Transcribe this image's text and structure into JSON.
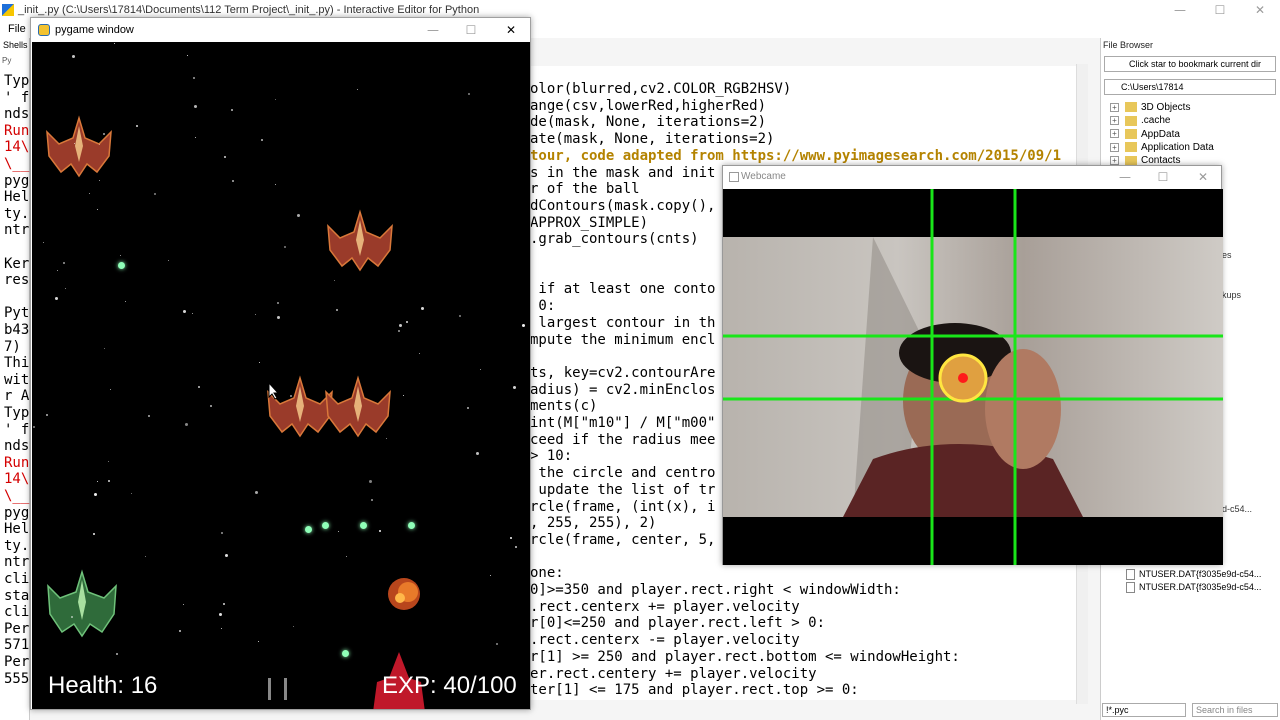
{
  "ide": {
    "title": "_init_.py (C:\\Users\\17814\\Documents\\112 Term Project\\_init_.py) - Interactive Editor for Python",
    "menu_file": "File",
    "shells_label": "Shells",
    "shells_tab": "Py",
    "controls": {
      "minimize": "—",
      "maximize": "☐",
      "close": "✕"
    }
  },
  "shell_lines": [
    "Typ",
    "' f",
    "nds",
    "Run",
    "14\\",
    "\\__",
    "pyg",
    "Hel",
    "ty.",
    "ntr",
    "",
    "Ker",
    "res",
    "",
    "Pyt",
    "b43",
    "7)",
    "Thi",
    "wit",
    "r A",
    "Typ",
    "' f",
    "nds",
    "Run",
    "14\\",
    "\\__",
    "pyg",
    "Hel",
    "ty.",
    "ntr",
    "cli",
    "sta",
    "cli",
    "Per",
    "571",
    "Per",
    "555"
  ],
  "code_lines": [
    "olor(blurred,cv2.COLOR_RGB2HSV)",
    "ange(csv,lowerRed,higherRed)",
    "de(mask, None, iterations=2)",
    "ate(mask, None, iterations=2)",
    "tour, code adapted from https://www.pyimagesearch.com/2015/09/1",
    "s in the mask and init",
    "r of the ball",
    "dContours(mask.copy(),",
    "APPROX_SIMPLE)",
    ".grab_contours(cnts)",
    "",
    "",
    " if at least one conto",
    " 0:",
    " largest contour in th",
    "mpute the minimum encl",
    "",
    "ts, key=cv2.contourAre",
    "adius) = cv2.minEnclos",
    "ments(c)",
    "int(M[\"m10\"] / M[\"m00\"",
    "ceed if the radius mee",
    "> 10:",
    " the circle and centro",
    " update the list of tr",
    "rcle(frame, (int(x), i",
    ", 255, 255), 2)",
    "rcle(frame, center, 5,",
    "",
    "one:",
    "0]>=350 and player.rect.right < windowWidth:",
    ".rect.centerx += player.velocity",
    "r[0]<=250 and player.rect.left > 0:",
    ".rect.centerx -= player.velocity",
    "r[1] >= 250 and player.rect.bottom <= windowHeight:",
    "er.rect.centery += player.velocity",
    "ter[1] <= 175 and player.rect.top >= 0:"
  ],
  "file_browser": {
    "title": "File Browser",
    "bookmark_hint": "Click star to bookmark current dir",
    "path": "C:\\Users\\17814",
    "items": [
      {
        "label": "3D Objects",
        "kind": "folder"
      },
      {
        "label": ".cache",
        "kind": "folder"
      },
      {
        "label": "AppData",
        "kind": "folder"
      },
      {
        "label": "Application Data",
        "kind": "folder"
      },
      {
        "label": "Contacts",
        "kind": "folder"
      }
    ],
    "files": [
      {
        "label": "NTUSER.DAT{f3035e9d-c54..."
      },
      {
        "label": "NTUSER.DAT{f3035e9d-c54..."
      }
    ],
    "side_fragments": {
      "a": "es",
      "b": "kups",
      "c": "d-c54..."
    },
    "filter": "!*.pyc",
    "search_placeholder": "Search in files"
  },
  "pygame": {
    "title": "pygame window",
    "health": "Health: 16",
    "exp": "EXP: 40/100"
  },
  "webcam": {
    "title": "Webcame"
  },
  "colors": {
    "grid_green": "#19e619",
    "hud_text": "#ffffff",
    "prompt_red": "#d40000",
    "traceback_red": "#d40000",
    "bullet_green": "#8fffb8"
  }
}
